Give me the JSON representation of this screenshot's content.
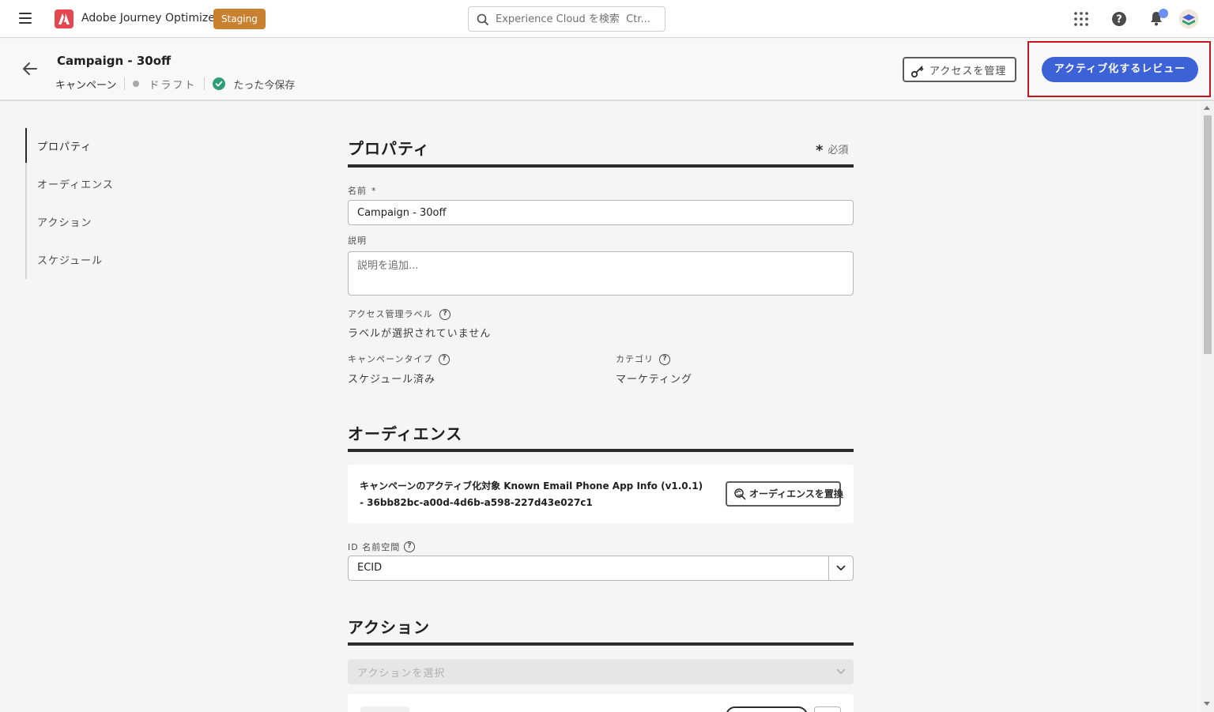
{
  "shell": {
    "app_name": "Adobe Journey Optimizer",
    "environment_badge": "Staging",
    "search_placeholder": "Experience Cloud を検索  Ctr..."
  },
  "header": {
    "title": "Campaign - 30off",
    "object_type": "キャンペーン",
    "status": "ドラフト",
    "save_status": "たった今保存",
    "manage_access_label": "アクセスを管理",
    "review_activate_label": "アクティブ化するレビュー"
  },
  "leftnav": {
    "items": [
      {
        "label": "プロパティ",
        "active": true
      },
      {
        "label": "オーディエンス",
        "active": false
      },
      {
        "label": "アクション",
        "active": false
      },
      {
        "label": "スケジュール",
        "active": false
      }
    ]
  },
  "properties": {
    "section_title": "プロパティ",
    "required_note": "必須",
    "required_mark": "*",
    "name_label": "名前",
    "name_value": "Campaign - 30off",
    "description_label": "説明",
    "description_placeholder": "説明を追加...",
    "access_label_title": "アクセス管理ラベル",
    "access_label_value": "ラベルが選択されていません",
    "campaign_type_label": "キャンペーンタイプ",
    "campaign_type_value": "スケジュール済み",
    "category_label": "カテゴリ",
    "category_value": "マーケティング",
    "help_glyph": "?"
  },
  "audience": {
    "section_title": "オーディエンス",
    "description": "キャンペーンのアクティブ化対象  Known Email Phone App Info (v1.0.1) - 36bb82bc-a00d-4d6b-a598-227d43e027c1",
    "replace_label": "オーディエンスを置換",
    "namespace_label": "ID 名前空間",
    "namespace_value": "ECID"
  },
  "actions": {
    "section_title": "アクション",
    "select_placeholder": "アクションを選択"
  },
  "colors": {
    "accent": "#3d62d6",
    "staging": "#c9802f",
    "saved_check": "#2d9d78",
    "highlight": "#c4141c"
  }
}
